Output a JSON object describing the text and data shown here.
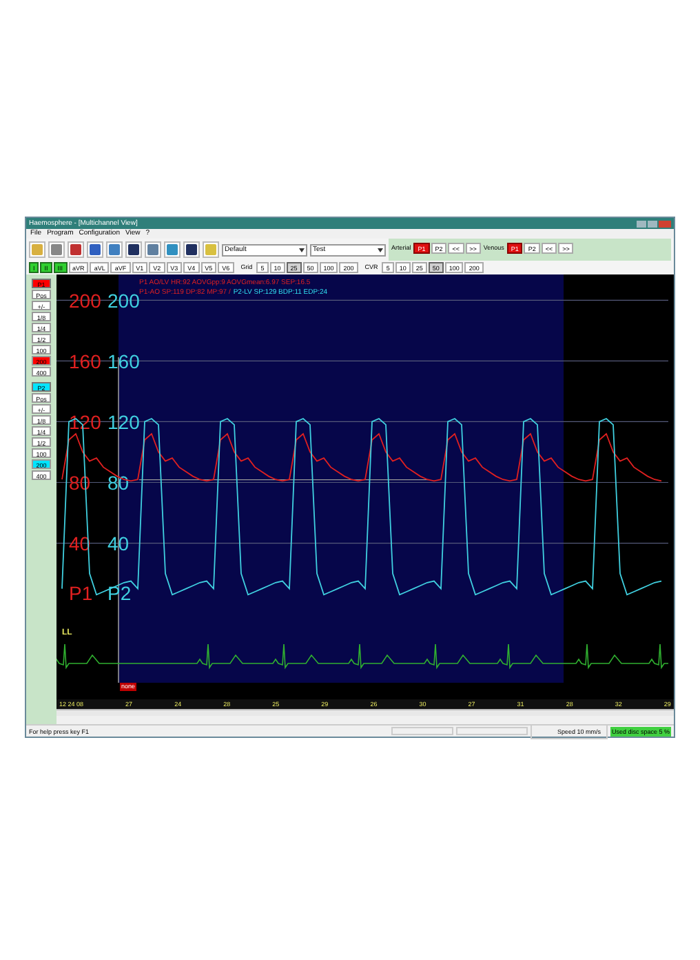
{
  "window": {
    "title": "Haemosphere - [Multichannel View]"
  },
  "menu": [
    "File",
    "Program",
    "Configuration",
    "View",
    "?"
  ],
  "toolbar": {
    "profile": "Default",
    "protocol": "Test",
    "arterial": {
      "label": "Arterial",
      "buttons": [
        {
          "label": "P1",
          "selected": true
        },
        {
          "label": "P2",
          "selected": false
        },
        {
          "label": "<<",
          "selected": false
        },
        {
          "label": ">>",
          "selected": false
        }
      ]
    },
    "venous": {
      "label": "Venous",
      "buttons": [
        {
          "label": "P1",
          "selected": true
        },
        {
          "label": "P2",
          "selected": false
        },
        {
          "label": "<<",
          "selected": false
        },
        {
          "label": ">>",
          "selected": false
        }
      ]
    }
  },
  "leads": [
    {
      "label": "I",
      "selected": true
    },
    {
      "label": "II",
      "selected": true
    },
    {
      "label": "III",
      "selected": true
    },
    {
      "label": "aVR",
      "selected": false
    },
    {
      "label": "aVL",
      "selected": false
    },
    {
      "label": "aVF",
      "selected": false
    },
    {
      "label": "V1",
      "selected": false
    },
    {
      "label": "V2",
      "selected": false
    },
    {
      "label": "V3",
      "selected": false
    },
    {
      "label": "V4",
      "selected": false
    },
    {
      "label": "V5",
      "selected": false
    },
    {
      "label": "V6",
      "selected": false
    }
  ],
  "grid": {
    "label": "Grid",
    "buttons": [
      {
        "label": "5",
        "selected": false
      },
      {
        "label": "10",
        "selected": false
      },
      {
        "label": "25",
        "selected": true
      },
      {
        "label": "50",
        "selected": false
      },
      {
        "label": "100",
        "selected": false
      },
      {
        "label": "200",
        "selected": false
      }
    ]
  },
  "cvr": {
    "label": "CVR",
    "buttons": [
      {
        "label": "5",
        "selected": false
      },
      {
        "label": "10",
        "selected": false
      },
      {
        "label": "25",
        "selected": false
      },
      {
        "label": "50",
        "selected": true
      },
      {
        "label": "100",
        "selected": false
      },
      {
        "label": "200",
        "selected": false
      }
    ]
  },
  "sidebar": [
    {
      "channel": "P1",
      "color": "#ff0000",
      "items": [
        {
          "label": "Pos",
          "selected": false
        },
        {
          "label": "+/-",
          "selected": false
        },
        {
          "label": "1/8",
          "selected": false
        },
        {
          "label": "1/4",
          "selected": false
        },
        {
          "label": "1/2",
          "selected": false
        },
        {
          "label": "100",
          "selected": false
        },
        {
          "label": "200",
          "selected": true
        },
        {
          "label": "400",
          "selected": false
        }
      ]
    },
    {
      "channel": "P2",
      "color": "#00e5ff",
      "items": [
        {
          "label": "Pos",
          "selected": false
        },
        {
          "label": "+/-",
          "selected": false
        },
        {
          "label": "1/8",
          "selected": false
        },
        {
          "label": "1/4",
          "selected": false
        },
        {
          "label": "1/2",
          "selected": false
        },
        {
          "label": "100",
          "selected": false
        },
        {
          "label": "200",
          "selected": true
        },
        {
          "label": "400",
          "selected": false
        }
      ]
    }
  ],
  "chart": {
    "header_line_1": "P1 AO/LV HR:92 AOVGpp:9 AOVGmean:6.97 SEP:16.5",
    "header_line_2_p1": "P1-AO SP:119 DP:82 MP:97 /",
    "header_line_2_p2": "P2-LV SP:129 BDP:11 EDP:24",
    "p2_axis_ticks": [
      "200",
      "160",
      "120",
      "80",
      "40"
    ],
    "chart_data": {
      "type": "line",
      "ylim": [
        -52,
        217
      ],
      "grid": true,
      "yticks": [
        {
          "value": 40,
          "label": "40"
        },
        {
          "value": 80,
          "label": "80"
        },
        {
          "value": 120,
          "label": "120"
        },
        {
          "value": 160,
          "label": "160"
        },
        {
          "value": 200,
          "label": "200"
        }
      ],
      "series": [
        {
          "name": "P1",
          "color": "#e02020",
          "values": [
            82,
            108,
            112,
            100,
            94,
            96,
            90,
            87,
            84,
            82,
            81,
            82,
            108,
            112,
            100,
            94,
            96,
            90,
            87,
            84,
            82,
            81,
            82,
            108,
            112,
            100,
            94,
            96,
            90,
            87,
            84,
            82,
            81,
            82,
            108,
            112,
            100,
            94,
            96,
            90,
            87,
            84,
            82,
            81,
            82,
            108,
            112,
            100,
            94,
            96,
            90,
            87,
            84,
            82,
            81,
            82,
            108,
            112,
            100,
            94,
            96,
            90,
            87,
            84,
            82,
            81,
            82,
            108,
            112,
            100,
            94,
            96,
            90,
            87,
            84,
            82,
            81,
            82,
            108,
            112,
            100,
            94,
            96,
            90,
            87,
            84,
            82,
            81
          ]
        },
        {
          "name": "P2",
          "color": "#40d0e0",
          "values": [
            10,
            120,
            122,
            118,
            20,
            6,
            8,
            10,
            12,
            14,
            15,
            10,
            120,
            122,
            118,
            20,
            6,
            8,
            10,
            12,
            14,
            15,
            10,
            120,
            122,
            118,
            20,
            6,
            8,
            10,
            12,
            14,
            15,
            10,
            120,
            122,
            118,
            20,
            6,
            8,
            10,
            12,
            14,
            15,
            10,
            120,
            122,
            118,
            20,
            6,
            8,
            10,
            12,
            14,
            15,
            10,
            120,
            122,
            118,
            20,
            6,
            8,
            10,
            12,
            14,
            15,
            10,
            120,
            122,
            118,
            20,
            6,
            8,
            10,
            12,
            14,
            15,
            10,
            120,
            122,
            118,
            20,
            6,
            8,
            10,
            12,
            14,
            15
          ]
        }
      ]
    },
    "ecg_label": "LL",
    "event_label": "none",
    "time_ticks": [
      "12 24 08",
      "27",
      "24",
      "28",
      "25",
      "29",
      "26",
      "30",
      "27",
      "31",
      "28",
      "32",
      "29"
    ]
  },
  "status_bar": {
    "help": "For help press key F1",
    "speed": "Speed 10 mm/s",
    "disc": "Used disc space 5 %"
  }
}
